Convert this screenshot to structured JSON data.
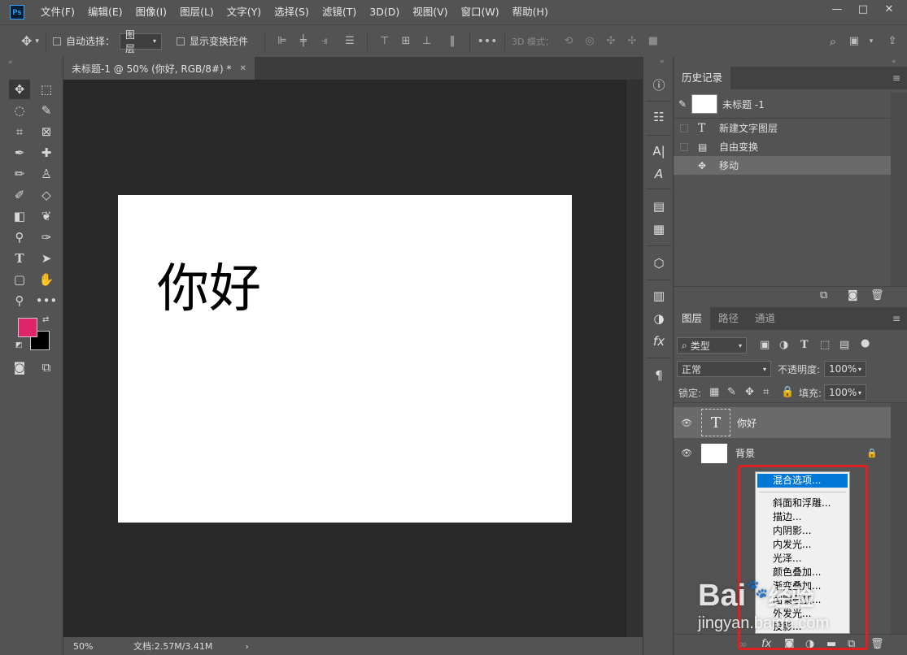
{
  "app": {
    "logo": "Ps"
  },
  "menubar": {
    "items": [
      "文件(F)",
      "编辑(E)",
      "图像(I)",
      "图层(L)",
      "文字(Y)",
      "选择(S)",
      "滤镜(T)",
      "3D(D)",
      "视图(V)",
      "窗口(W)",
      "帮助(H)"
    ],
    "win_controls": [
      "—",
      "□",
      "✕"
    ]
  },
  "options": {
    "auto_select_label": "自动选择：",
    "auto_select_value": "图层",
    "show_transform_label": "显示变换控件",
    "mode_3d_label": "3D 模式："
  },
  "document": {
    "tab_title": "未标题-1 @ 50% (你好, RGB/8#) *",
    "canvas_text": "你好",
    "zoom": "50%",
    "doc_info": "文档:2.57M/3.41M"
  },
  "colors": {
    "foreground": "#e0246a",
    "background": "#000000",
    "highlight": "#0078d7",
    "annotation": "#e02020"
  },
  "history": {
    "tab": "历史记录",
    "snapshot": "未标题 -1",
    "items": [
      {
        "icon": "text-tool-icon",
        "label": "新建文字图层"
      },
      {
        "icon": "document-icon",
        "label": "自由变换"
      },
      {
        "icon": "move-icon",
        "label": "移动"
      }
    ]
  },
  "layers": {
    "tabs": [
      "图层",
      "路径",
      "通道"
    ],
    "filter_label": "类型",
    "blend_mode": "正常",
    "opacity_label": "不透明度:",
    "opacity_value": "100%",
    "lock_label": "锁定:",
    "fill_label": "填充:",
    "fill_value": "100%",
    "items": [
      {
        "name": "你好",
        "thumb": "T"
      },
      {
        "name": "背景"
      }
    ]
  },
  "context_menu": {
    "items": [
      "混合选项...",
      "斜面和浮雕...",
      "描边...",
      "内阴影...",
      "内发光...",
      "光泽...",
      "颜色叠加...",
      "渐变叠加...",
      "图案叠加...",
      "外发光...",
      "投影..."
    ]
  },
  "watermark": {
    "brand": "Bai",
    "brand2": "经验",
    "url": "jingyan.baidu.com"
  }
}
